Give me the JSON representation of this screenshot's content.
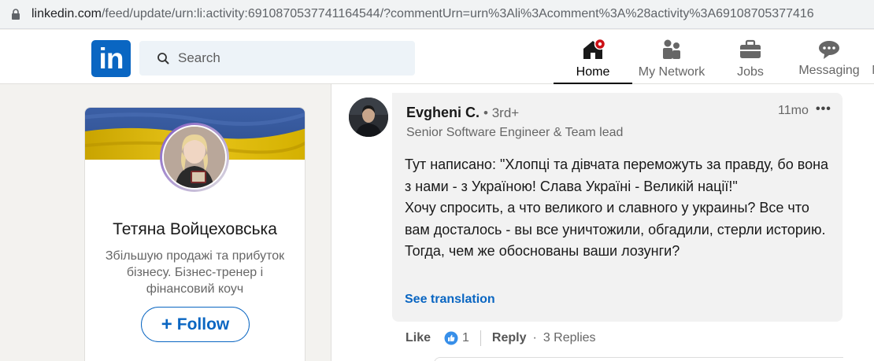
{
  "browser": {
    "url_host": "linkedin.com",
    "url_path": "/feed/update/urn:li:activity:6910870537741164544/?commentUrn=urn%3Ali%3Acomment%3A%28activity%3A69108705377416"
  },
  "nav": {
    "logo": "in",
    "search_placeholder": "Search",
    "items": [
      {
        "label": "Home",
        "icon": "home-icon"
      },
      {
        "label": "My Network",
        "icon": "network-icon"
      },
      {
        "label": "Jobs",
        "icon": "briefcase-icon"
      },
      {
        "label": "Messaging",
        "icon": "messaging-icon"
      },
      {
        "label": "N",
        "icon": "notifications-icon"
      }
    ]
  },
  "profile": {
    "name": "Тетяна Войцеховська",
    "headline": "Збільшую продажі та прибуток бізнесу. Бізнес-тренер і фінансовий коуч",
    "follow_label": "Follow"
  },
  "comment": {
    "author": "Evgheni C.",
    "degree": "• 3rd+",
    "title": "Senior Software Engineer & Team lead",
    "time": "11mo",
    "more": "•••",
    "body": [
      "Тут написано: \"Хлопці та дівчата переможуть за правду, бо вона з нами - з Україною! Слава Україні - Великій нації!\"",
      "Хочу спросить, а что великого и славного у украины? Все что вам досталось - вы все уничтожили, обгадили, стерли историю. Тогда, чем же обоснованы ваши лозунги?"
    ],
    "see_translation": "See translation",
    "actions": {
      "like": "Like",
      "reaction_count": "1",
      "reply": "Reply",
      "replies": "3 Replies"
    }
  },
  "colors": {
    "brand": "#0a66c2",
    "background": "#f3f2ef",
    "notification_badge": "#cc1016"
  }
}
